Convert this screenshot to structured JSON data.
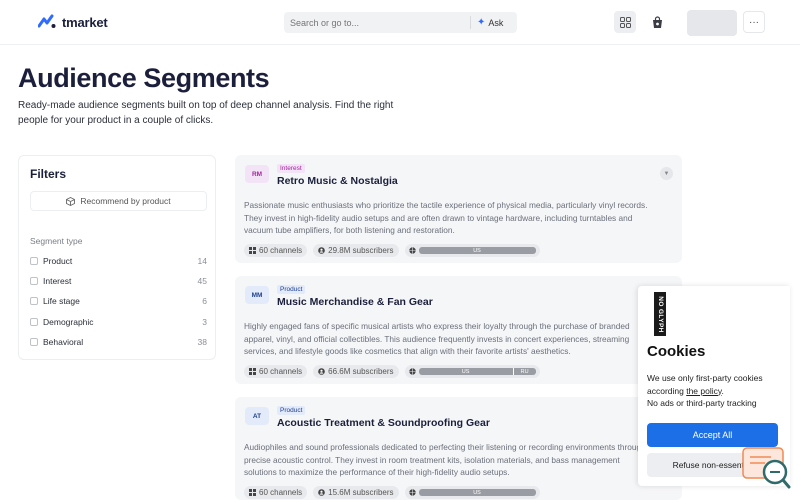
{
  "header": {
    "logo_text": "tmarket",
    "search_placeholder": "Search or go to...",
    "ask_label": "Ask"
  },
  "page": {
    "title": "Audience Segments",
    "subtitle": "Ready-made audience segments built on top of deep channel analysis. Find the right people for your product in a couple of clicks."
  },
  "filters": {
    "title": "Filters",
    "recommend_label": "Recommend by product",
    "segment_type_label": "Segment type",
    "items": [
      {
        "label": "Product",
        "count": "14"
      },
      {
        "label": "Interest",
        "count": "45"
      },
      {
        "label": "Life stage",
        "count": "6"
      },
      {
        "label": "Demographic",
        "count": "3"
      },
      {
        "label": "Behavioral",
        "count": "38"
      }
    ]
  },
  "cards": [
    {
      "badge": "RM",
      "tag": "Interest",
      "title": "Retro Music & Nostalgia",
      "description": "Passionate music enthusiasts who prioritize the tactile experience of physical media, particularly vinyl records. They invest in high-fidelity audio setups and are often drawn to vintage hardware, including turntables and vacuum tube amplifiers, for both listening and restoration.",
      "channels": "60 channels",
      "subscribers": "29.8M subscribers",
      "geo": [
        "US"
      ]
    },
    {
      "badge": "MM",
      "tag": "Product",
      "title": "Music Merchandise & Fan Gear",
      "description": "Highly engaged fans of specific musical artists who express their loyalty through the purchase of branded apparel, vinyl, and official collectibles. This audience frequently invests in concert experiences, streaming services, and lifestyle goods like cosmetics that align with their favorite artists' aesthetics.",
      "channels": "60 channels",
      "subscribers": "66.6M subscribers",
      "geo": [
        "US",
        "RU"
      ]
    },
    {
      "badge": "AT",
      "tag": "Product",
      "title": "Acoustic Treatment & Soundproofing Gear",
      "description": "Audiophiles and sound professionals dedicated to perfecting their listening or recording environments through precise acoustic control. They invest in room treatment kits, isolation materials, and bass management solutions to maximize the performance of their high-fidelity audio setups.",
      "channels": "60 channels",
      "subscribers": "15.6M subscribers",
      "geo": [
        "US"
      ]
    }
  ],
  "cookies": {
    "logo_text": "NO GLYPH",
    "title": "Cookies",
    "text_before": "We use only first-party cookies according ",
    "policy_link": "the policy",
    "text_after": ".",
    "line2": "No ads or third-party tracking",
    "accept_label": "Accept All",
    "refuse_label": "Refuse non-essential"
  },
  "colors": {
    "accent": "#1d6fe8",
    "interest_tag_bg": "#f3e3f7",
    "interest_tag_text": "#a3269b",
    "product_tag_bg": "#e3ebfb",
    "product_tag_text": "#1e3f8f"
  }
}
